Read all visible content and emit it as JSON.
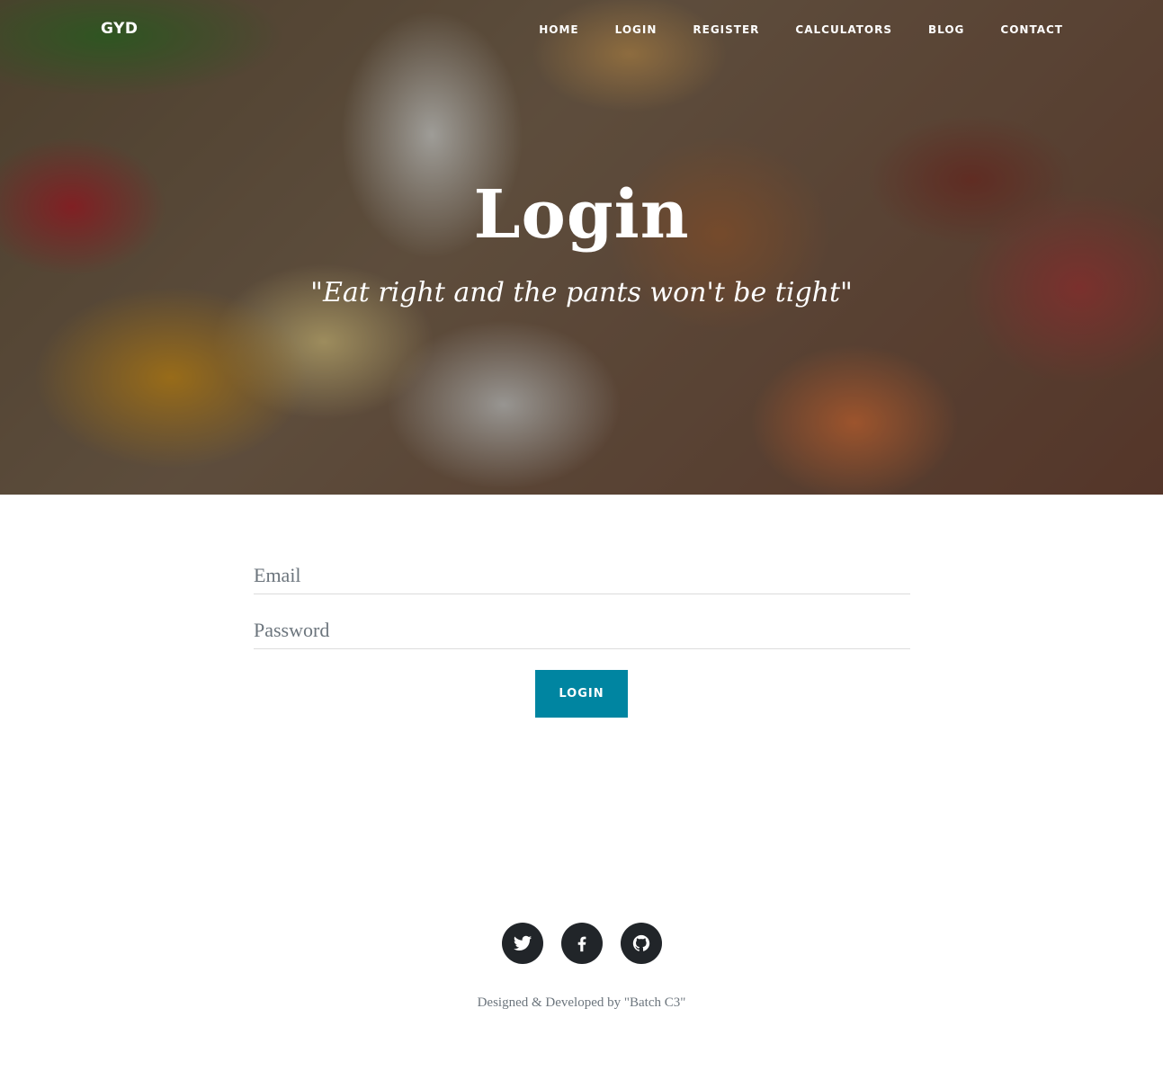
{
  "brand": "GYD",
  "nav": {
    "home": "HOME",
    "login": "LOGIN",
    "register": "REGISTER",
    "calculators": "CALCULATORS",
    "blog": "BLOG",
    "contact": "CONTACT"
  },
  "hero": {
    "title": "Login",
    "subtitle": "\"Eat right and the pants won't be tight\""
  },
  "form": {
    "email_placeholder": "Email",
    "password_placeholder": "Password",
    "submit_label": "LOGIN"
  },
  "social": {
    "icons": [
      "twitter-icon",
      "facebook-icon",
      "github-icon"
    ]
  },
  "footer": {
    "credit": "Designed & Developed by \"Batch C3\""
  },
  "colors": {
    "accent": "#0085a1",
    "social_bg": "#212529",
    "muted_text": "#6c757d"
  }
}
